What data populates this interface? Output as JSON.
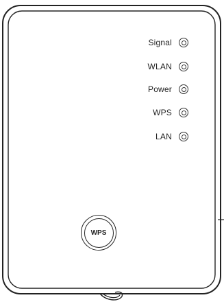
{
  "indicators": [
    {
      "label": "Signal"
    },
    {
      "label": "WLAN"
    },
    {
      "label": "Power"
    },
    {
      "label": "WPS"
    },
    {
      "label": "LAN"
    }
  ],
  "wps_button": {
    "label": "WPS"
  },
  "colors": {
    "outline": "#222222",
    "background": "#ffffff"
  }
}
